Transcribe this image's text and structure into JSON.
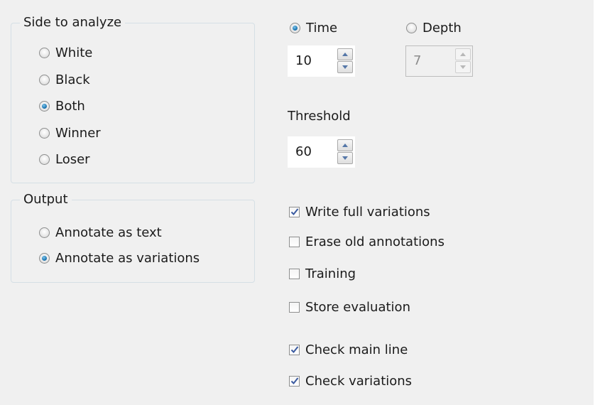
{
  "side_group": {
    "title": "Side to analyze",
    "options": [
      {
        "label": "White",
        "selected": false
      },
      {
        "label": "Black",
        "selected": false
      },
      {
        "label": "Both",
        "selected": true
      },
      {
        "label": "Winner",
        "selected": false
      },
      {
        "label": "Loser",
        "selected": false
      }
    ]
  },
  "output_group": {
    "title": "Output",
    "options": [
      {
        "label": "Annotate as text",
        "selected": false
      },
      {
        "label": "Annotate as variations",
        "selected": true
      }
    ]
  },
  "limit": {
    "time": {
      "label": "Time",
      "selected": true,
      "value": "10"
    },
    "depth": {
      "label": "Depth",
      "selected": false,
      "value": "7",
      "enabled": false
    }
  },
  "threshold": {
    "label": "Threshold",
    "value": "60"
  },
  "checkboxes": [
    {
      "label": "Write full variations",
      "checked": true
    },
    {
      "label": "Erase old annotations",
      "checked": false
    },
    {
      "label": "Training",
      "checked": false
    },
    {
      "label": "Store evaluation",
      "checked": false
    },
    {
      "label": "Check main line",
      "checked": true
    },
    {
      "label": "Check variations",
      "checked": true
    }
  ],
  "colors": {
    "panel": "#f0f0f0",
    "radio_dot": "#1e78b4",
    "check_mark": "#3a5aa0"
  },
  "icons": {
    "spin_up": "triangle-up-icon",
    "spin_down": "triangle-down-icon",
    "check": "checkmark-icon"
  }
}
